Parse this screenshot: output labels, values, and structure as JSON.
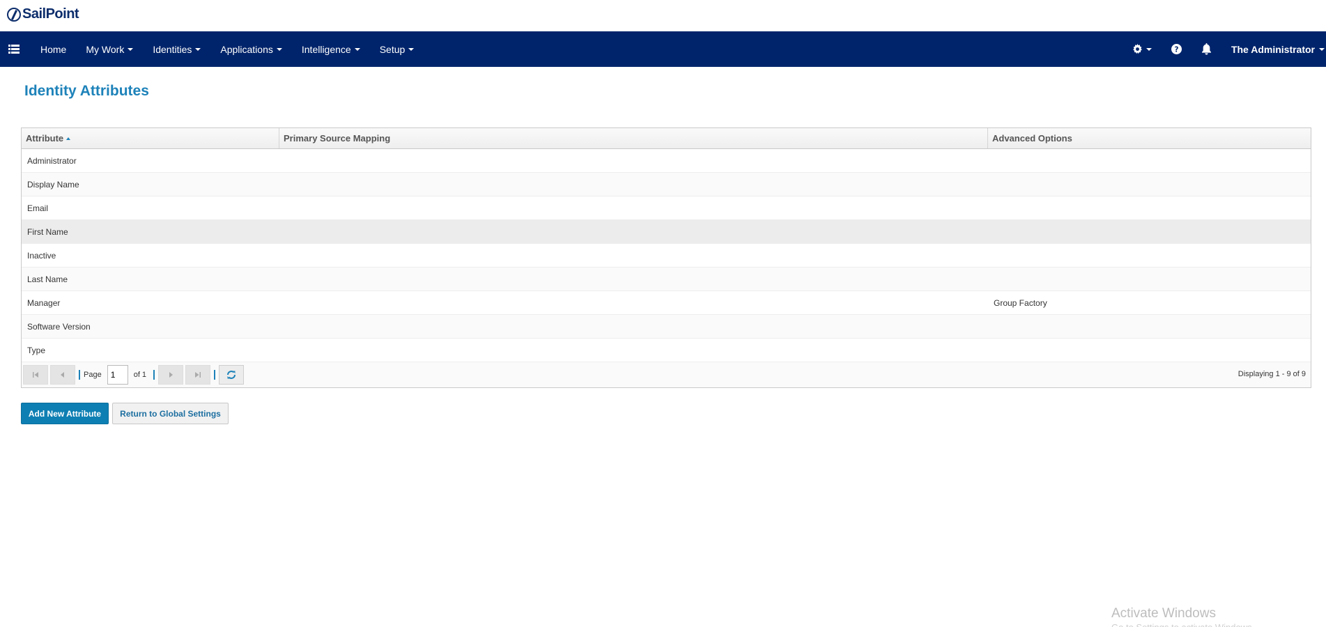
{
  "brand": {
    "name": "SailPoint"
  },
  "nav": {
    "items": [
      {
        "label": "Home",
        "dropdown": false
      },
      {
        "label": "My Work",
        "dropdown": true
      },
      {
        "label": "Identities",
        "dropdown": true
      },
      {
        "label": "Applications",
        "dropdown": true
      },
      {
        "label": "Intelligence",
        "dropdown": true
      },
      {
        "label": "Setup",
        "dropdown": true
      }
    ],
    "user": "The Administrator",
    "icons": [
      "menu-list-icon",
      "gear-icon",
      "help-icon",
      "bell-icon"
    ]
  },
  "page": {
    "title": "Identity Attributes"
  },
  "grid": {
    "columns": [
      "Attribute",
      "Primary Source Mapping",
      "Advanced Options"
    ],
    "sort": {
      "column": "Attribute",
      "direction": "ascending"
    },
    "rows": [
      {
        "attribute": "Administrator",
        "mapping": "",
        "options": ""
      },
      {
        "attribute": "Display Name",
        "mapping": "",
        "options": ""
      },
      {
        "attribute": "Email",
        "mapping": "",
        "options": ""
      },
      {
        "attribute": "First Name",
        "mapping": "",
        "options": ""
      },
      {
        "attribute": "Inactive",
        "mapping": "",
        "options": ""
      },
      {
        "attribute": "Last Name",
        "mapping": "",
        "options": ""
      },
      {
        "attribute": "Manager",
        "mapping": "",
        "options": "Group Factory"
      },
      {
        "attribute": "Software Version",
        "mapping": "",
        "options": ""
      },
      {
        "attribute": "Type",
        "mapping": "",
        "options": ""
      }
    ],
    "pager": {
      "page_label": "Page",
      "page_value": "1",
      "of_label": "of 1",
      "displaying": "Displaying 1 - 9 of 9"
    }
  },
  "buttons": {
    "add": "Add New Attribute",
    "return": "Return to Global Settings"
  },
  "watermark": {
    "title": "Activate Windows",
    "subtitle": "Go to Settings to activate Windows."
  },
  "colors": {
    "navbar": "#00246b",
    "title": "#1d82b9",
    "primary_button": "#0e7fb3"
  }
}
